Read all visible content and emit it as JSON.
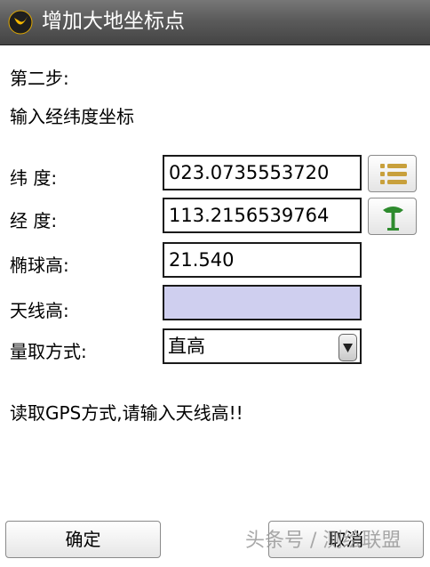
{
  "window": {
    "title": "增加大地坐标点"
  },
  "step": {
    "label": "第二步:",
    "instruction": "输入经纬度坐标"
  },
  "form": {
    "latitude": {
      "label": "纬 度:",
      "value": "023.0735553720"
    },
    "longitude": {
      "label": "经 度:",
      "value": "113.2156539764"
    },
    "ellipsoid_height": {
      "label": "椭球高:",
      "value": "21.540"
    },
    "antenna_height": {
      "label": "天线高:",
      "value": ""
    },
    "measure_method": {
      "label": "量取方式:",
      "selected": "直高"
    }
  },
  "message": "读取GPS方式,请输入天线高!!",
  "buttons": {
    "confirm": "确定",
    "cancel": "取消"
  },
  "watermark": "头条号 / 测绘联盟",
  "icons": {
    "app": "app-logo-icon",
    "list": "list-icon",
    "gps": "gps-antenna-icon",
    "dropdown": "dropdown-arrow-icon"
  },
  "colors": {
    "titlebar": "#5b5b5b",
    "antenna_field": "#cfcfef",
    "list_icon": "#c8a03c",
    "gps_icon": "#2e8b2e"
  }
}
